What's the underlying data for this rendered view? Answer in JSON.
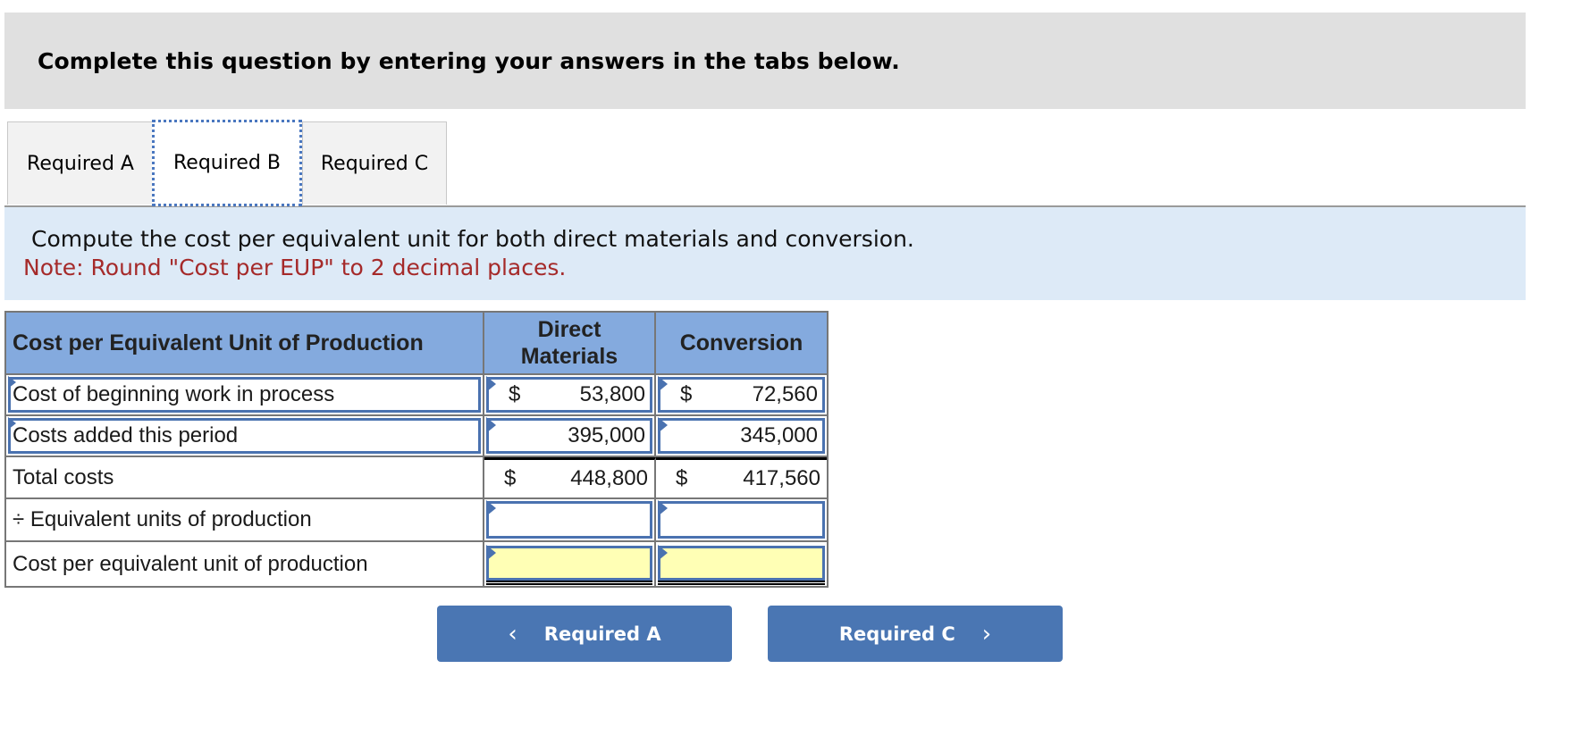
{
  "header": {
    "title": "Complete this question by entering your answers in the tabs below."
  },
  "tabs": [
    {
      "label": "Required A",
      "active": false
    },
    {
      "label": "Required B",
      "active": true
    },
    {
      "label": "Required C",
      "active": false
    }
  ],
  "prompt": {
    "instruction": "Compute the cost per equivalent unit for both direct materials and conversion.",
    "note": "Note: Round \"Cost per EUP\" to 2 decimal places."
  },
  "table": {
    "headers": {
      "label": "Cost per Equivalent Unit of Production",
      "direct_materials": "Direct Materials",
      "conversion": "Conversion"
    },
    "currency_symbol": "$",
    "rows": [
      {
        "label": "Cost of beginning work in process",
        "direct_materials": "53,800",
        "conversion": "72,560",
        "show_currency": true
      },
      {
        "label": "Costs added this period",
        "direct_materials": "395,000",
        "conversion": "345,000",
        "show_currency": false
      },
      {
        "label": "Total costs",
        "direct_materials": "448,800",
        "conversion": "417,560",
        "show_currency": true
      },
      {
        "label": "÷ Equivalent units of production",
        "direct_materials": "",
        "conversion": ""
      },
      {
        "label": "Cost per equivalent unit of production",
        "direct_materials": "",
        "conversion": ""
      }
    ]
  },
  "navigation": {
    "prev_label": "Required A",
    "next_label": "Required C",
    "prev_icon": "chevron-left-icon",
    "next_icon": "chevron-right-icon"
  },
  "colors": {
    "header_bar": "#e0e0e0",
    "prompt_band": "#ddeaf7",
    "note_text": "#a52a2a",
    "table_header": "#84aade",
    "input_border": "#4a72b0",
    "answer_fill": "#ffffb5",
    "button": "#4a76b3"
  }
}
